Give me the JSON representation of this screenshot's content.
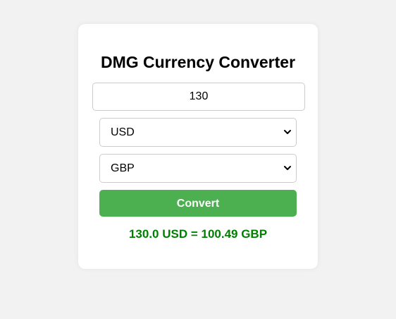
{
  "converter": {
    "title": "DMG Currency Converter",
    "amount_value": "130",
    "from_currency": "USD",
    "to_currency": "GBP",
    "convert_label": "Convert",
    "result_text": "130.0 USD = 100.49 GBP"
  },
  "colors": {
    "page_background": "#f2f2f2",
    "card_background": "#ffffff",
    "button_green": "#4caf50",
    "result_green": "#008000"
  },
  "icons": {
    "dropdown": "chevron-down-icon"
  }
}
